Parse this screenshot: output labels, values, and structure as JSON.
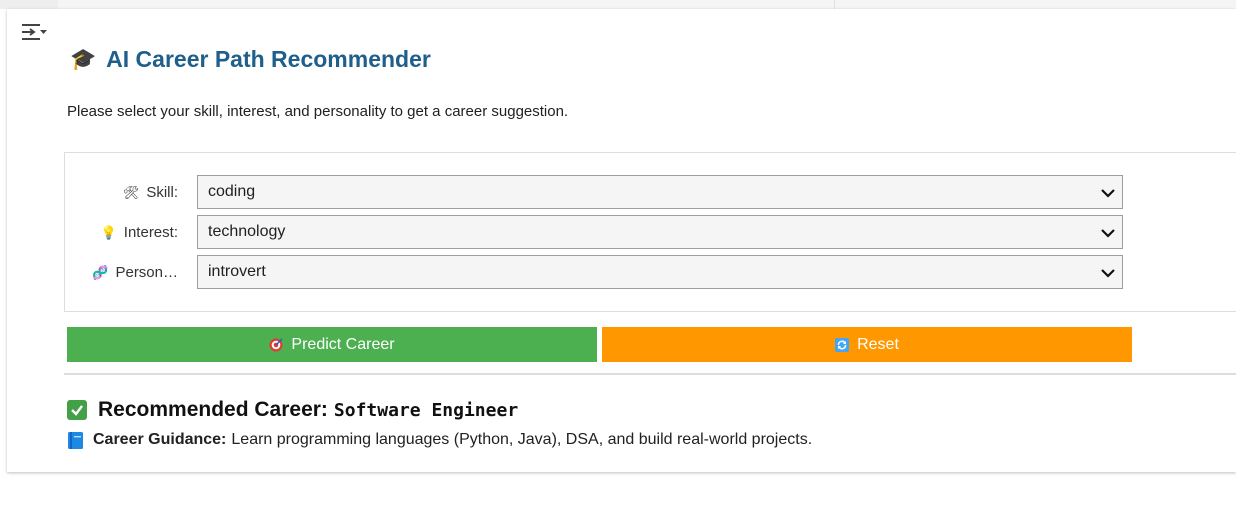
{
  "app": {
    "title": "AI Career Path Recommender",
    "title_icon": "graduation-cap-icon",
    "subtitle": "Please select your skill, interest, and personality to get a career suggestion."
  },
  "form": {
    "skill": {
      "icon": "tools-icon",
      "label": "Skill:",
      "value": "coding"
    },
    "interest": {
      "icon": "lightbulb-icon",
      "label": "Interest:",
      "value": "technology"
    },
    "personality": {
      "icon": "dna-icon",
      "label": "Person…",
      "value": "introvert"
    }
  },
  "buttons": {
    "predict": {
      "icon": "target-icon",
      "label": "Predict Career",
      "color": "#4caf50"
    },
    "reset": {
      "icon": "refresh-icon",
      "label": "Reset",
      "color": "#ff9800"
    }
  },
  "result": {
    "icon": "check-mark-icon",
    "label": "Recommended Career:",
    "value": "Software Engineer",
    "guidance_icon": "book-icon",
    "guidance_label": "Career Guidance:",
    "guidance_text": "Learn programming languages (Python, Java), DSA, and build real-world projects."
  },
  "colors": {
    "title": "#1f5f8b",
    "predict": "#4caf50",
    "reset": "#ff9800"
  }
}
